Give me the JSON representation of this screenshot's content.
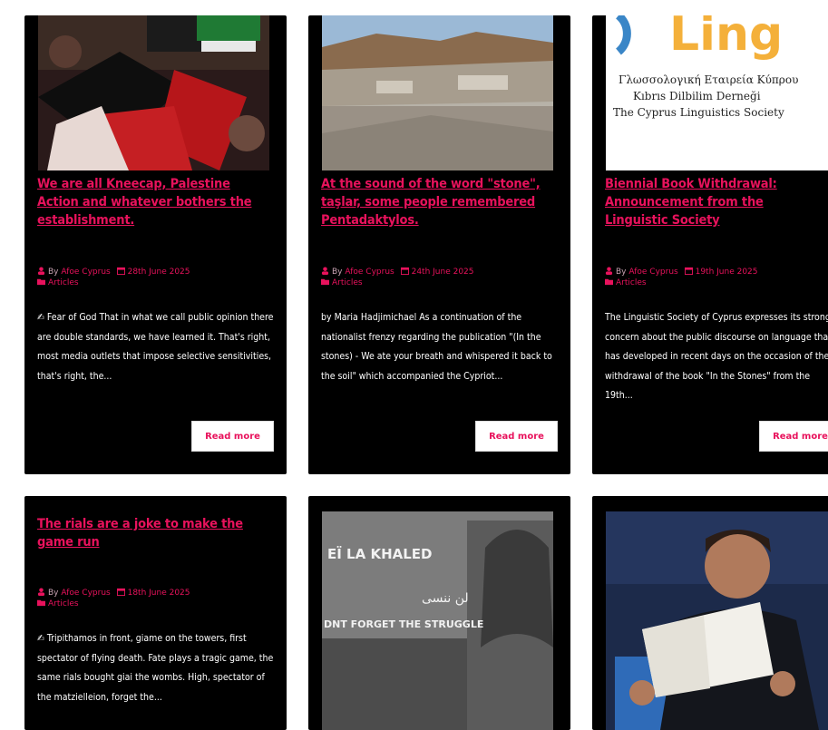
{
  "cards": [
    {
      "title": "We are all Kneecap, Palestine Action and whatever bothers the establishment.",
      "by_prefix": "By",
      "author": "Afoe Cyprus",
      "date": "28th June 2025",
      "category": "Articles",
      "excerpt": "✍ Fear of God That in what we call public opinion there are double standards, we have learned it. That's right, most media outlets that impose selective sensitivities, that's right, the...",
      "read_more": "Read more",
      "image": "kneecap-protest-flags"
    },
    {
      "title": "At the sound of the word \"stone\", taşlar, some people remembered Pentadaktylos.",
      "by_prefix": "By",
      "author": "Afoe Cyprus",
      "date": "24th June 2025",
      "category": "Articles",
      "excerpt": "by Maria Hadjimichael As a continuation of the nationalist frenzy regarding the publication \"(In the stones) - We ate your breath and whispered it back to the soil\" which accompanied the Cypriot...",
      "read_more": "Read more",
      "image": "quarry-landscape"
    },
    {
      "title": "Biennial Book Withdrawal: Announcement from the Linguistic Society",
      "by_prefix": "By",
      "author": "Afoe Cyprus",
      "date": "19th June 2025",
      "category": "Articles",
      "excerpt": "The Linguistic Society of Cyprus expresses its strong concern about the public discourse on language that has developed in recent days on the occasion of the withdrawal of the book \"In the Stones\" from the 19th...",
      "read_more": "Read more",
      "image": "linguistics-society-logo",
      "logo_text": "Ling",
      "logo_lines": [
        "Γλωσσολογική Εταιρεία Κύπρου",
        "Kıbrıs Dilbilim Derneği",
        "The Cyprus Linguistics Society"
      ]
    },
    {
      "title": "The rials are a joke to make the game run",
      "by_prefix": "By",
      "author": "Afoe Cyprus",
      "date": "18th June 2025",
      "category": "Articles",
      "excerpt": "✍ Tripithamos in front, giame on the towers, first spectator of flying death. Fate plays a tragic game, the same rials bought giai the wombs. High, spectator of the matzielleion, forget the..."
    },
    {
      "image": "leila-khaled-mural",
      "mural_lines": [
        "EÏ LA KHALED",
        "لن ننسى",
        "DNT  FORGET THE STRUGGLE"
      ]
    },
    {
      "image": "man-reading-paper-tv"
    }
  ]
}
